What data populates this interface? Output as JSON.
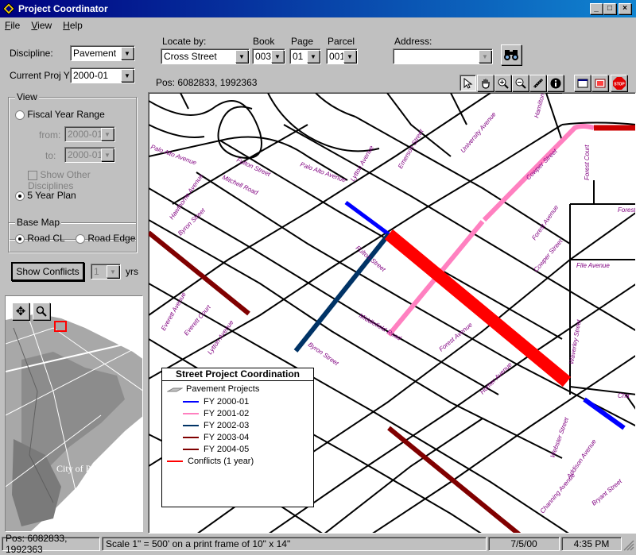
{
  "window": {
    "title": "Project Coordinator"
  },
  "menu": [
    "File",
    "View",
    "Help"
  ],
  "left": {
    "discipline_label": "Discipline:",
    "discipline_value": "Pavement",
    "proj_yr_label": "Current Proj Yr:",
    "proj_yr_value": "2000-01",
    "view_group": "View",
    "fiscal_range": "Fiscal Year Range",
    "from_label": "from:",
    "from_value": "2000-01",
    "to_label": "to:",
    "to_value": "2000-01",
    "show_other": "Show Other Disciplines",
    "five_year": "5 Year Plan",
    "basemap_group": "Base Map",
    "road_cl": "Road CL",
    "road_edge": "Road Edge",
    "show_conflicts": "Show Conflicts",
    "conflicts_value": "1",
    "yrs": "yrs",
    "overview_label": "City of Palo Alto"
  },
  "toolbar": {
    "locate_label": "Locate by:",
    "locate_value": "Cross Street",
    "book_label": "Book",
    "book_value": "003",
    "page_label": "Page",
    "page_value": "01",
    "parcel_label": "Parcel",
    "parcel_value": "001",
    "address_label": "Address:",
    "address_value": ""
  },
  "posbar": {
    "pos": "Pos: 6082833, 1992363"
  },
  "legend": {
    "title": "Street Project Coordination",
    "group": "Pavement Projects",
    "items": [
      {
        "label": "FY 2000-01",
        "color": "#0000ff"
      },
      {
        "label": "FY 2001-02",
        "color": "#ff80c0"
      },
      {
        "label": "FY 2002-03",
        "color": "#003366"
      },
      {
        "label": "FY 2003-04",
        "color": "#800000"
      },
      {
        "label": "FY 2004-05",
        "color": "#800000"
      }
    ],
    "conflicts": "Conflicts (1 year)",
    "conflicts_color": "#ff0000"
  },
  "map_labels": [
    "Palo Alto Avenue",
    "Mitchell Road",
    "Palo Alto Avenue",
    "Fulton Street",
    "Lytton Avenue",
    "Emerson Street",
    "University Avenue",
    "Hamilton Avenue",
    "Forest Court",
    "Cowper Street",
    "Hawthorne Avenue",
    "Byron Street",
    "Fulton Street",
    "Cowper Street",
    "Forest Avenue",
    "Everett Avenue",
    "Everett Court",
    "Lytton Avenue",
    "Byron Street",
    "Middlefield Road",
    "Forest Avenue",
    "Waverley Street",
    "Addison Avenue",
    "Homer Avenue",
    "Channing Avenue",
    "Webster Street",
    "Bryant Street",
    "Forest",
    "File Avenue",
    "Cha"
  ],
  "status": {
    "pos": "Pos: 6082833, 1992363",
    "scale": "Scale 1\" = 500' on a print frame of 10\" x 14\"",
    "date": "7/5/00",
    "time": "4:35 PM"
  }
}
